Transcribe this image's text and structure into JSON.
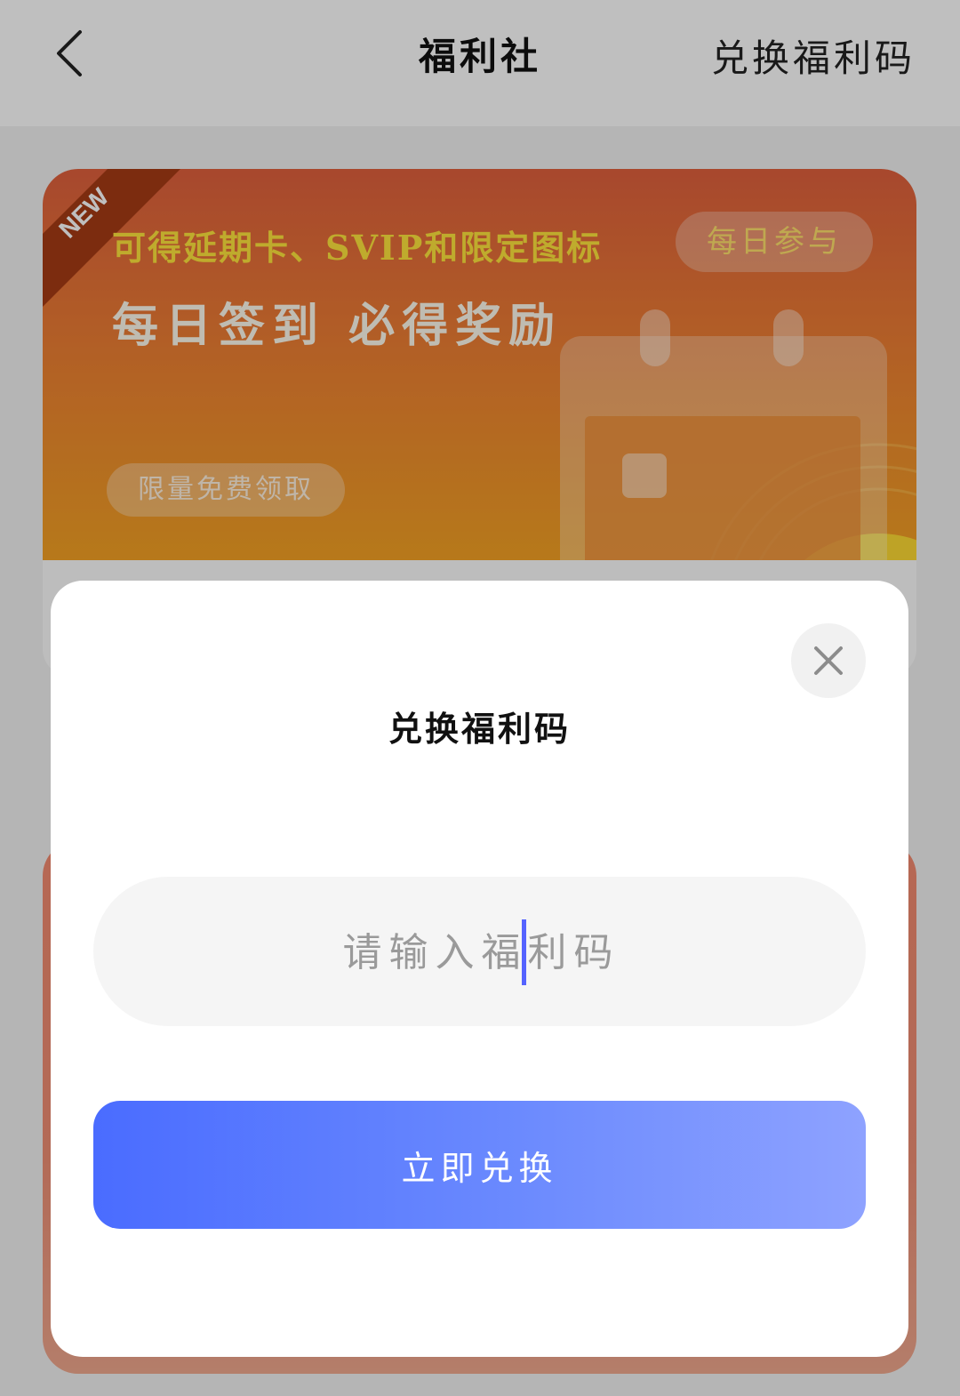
{
  "header": {
    "title": "福利社",
    "redeem_link": "兑换福利码"
  },
  "banner": {
    "ribbon": "NEW",
    "subtitle": "可得延期卡、SVIP和限定图标",
    "chip": "每日参与",
    "title": "每日签到 必得奖励",
    "pill": "限量免费领取"
  },
  "modal": {
    "title": "兑换福利码",
    "input_placeholder": "请输入福利码",
    "input_value": "",
    "button_label": "立即兑换"
  },
  "colors": {
    "accent": "#4a6cff",
    "banner_start": "#e0603d",
    "banner_end": "#f4a224",
    "caret": "#5563ff"
  },
  "icons": [
    "back-arrow-icon",
    "close-icon",
    "calendar-icon"
  ]
}
